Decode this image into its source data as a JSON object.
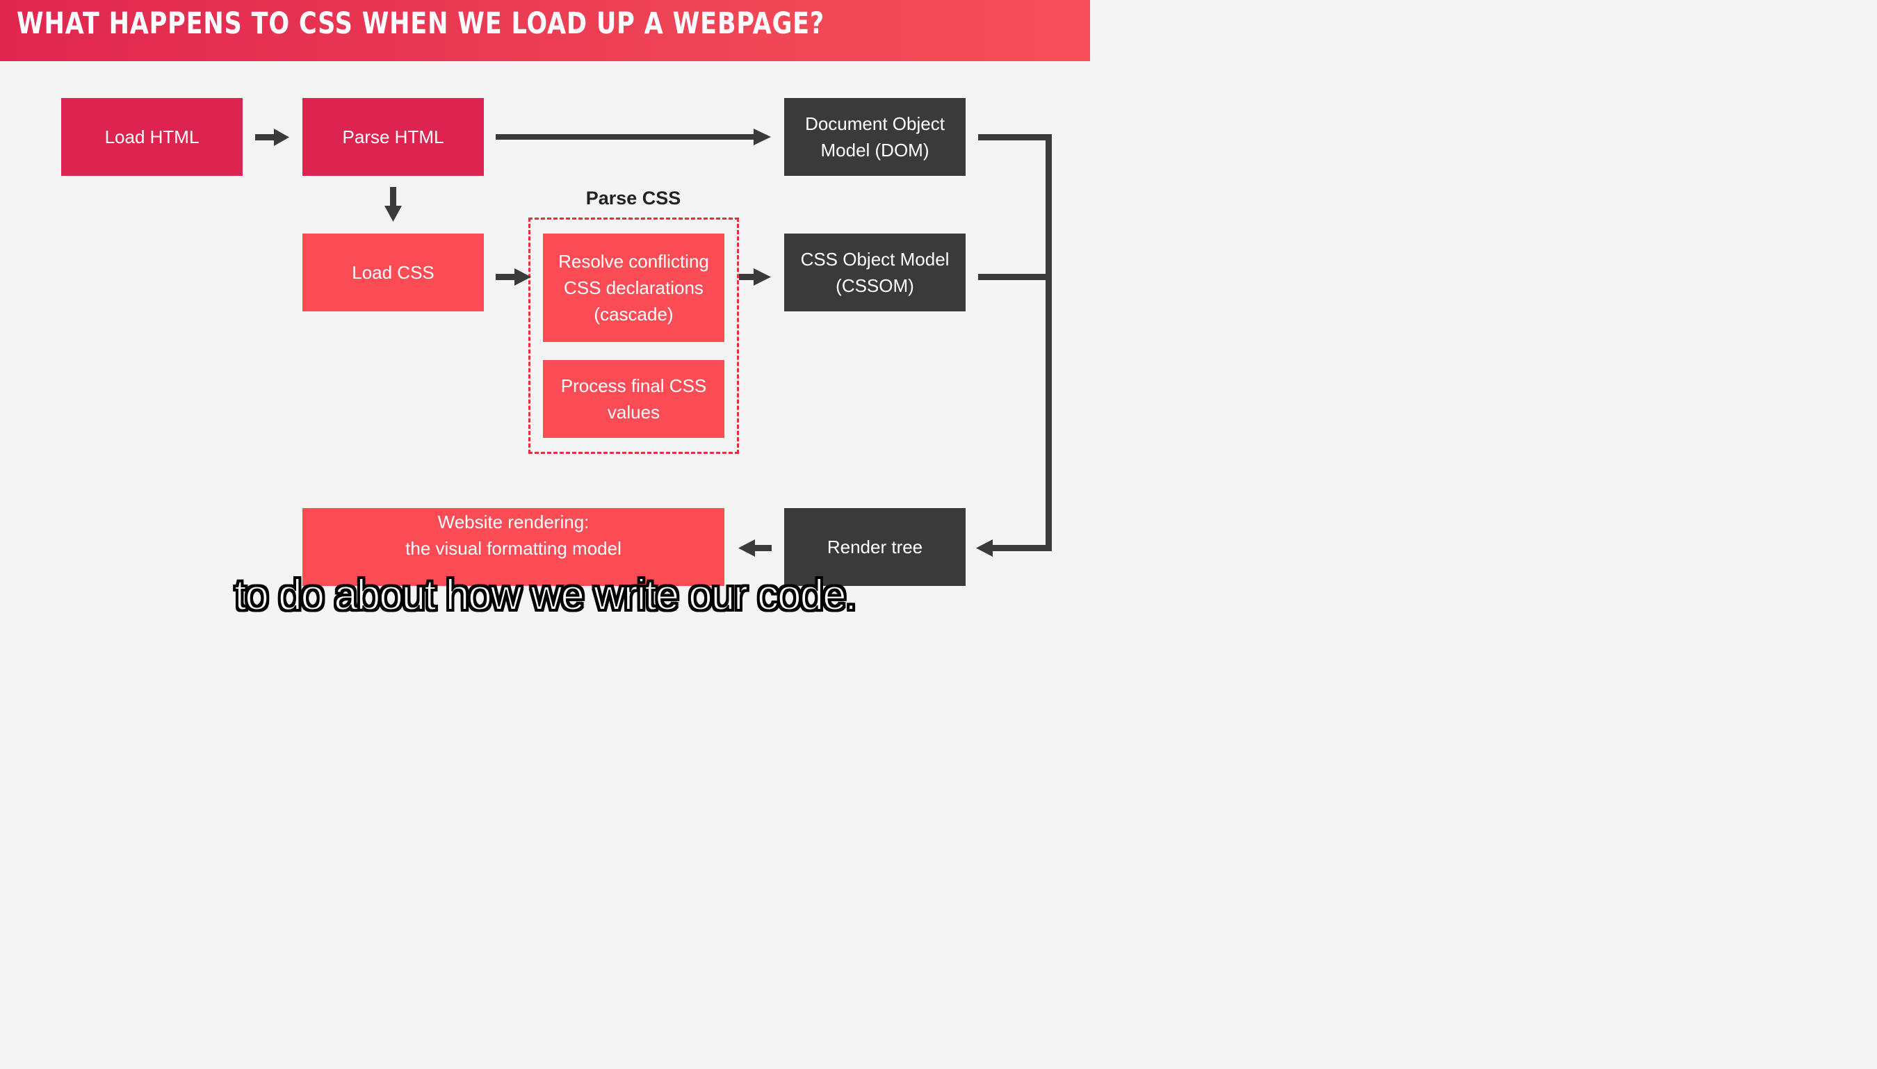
{
  "header": {
    "title": "WHAT HAPPENS TO CSS WHEN WE LOAD UP A WEBPAGE?"
  },
  "diagram": {
    "load_html": "Load HTML",
    "parse_html": "Parse HTML",
    "dom": "Document Object\nModel (DOM)",
    "parse_css_label": "Parse CSS",
    "load_css": "Load CSS",
    "resolve": "Resolve conflicting\nCSS declarations\n(cascade)",
    "process": "Process final CSS\nvalues",
    "cssom": "CSS Object Model\n(CSSOM)",
    "render_tree": "Render tree",
    "website_rendering": "Website rendering:\nthe visual formatting model"
  },
  "subtitle": "to do about how we write our code.",
  "colors": {
    "header": "#e0264f",
    "dark_red": "#dd2350",
    "coral": "#fb4b54",
    "dark": "#3a3a3a",
    "arrow": "#3a3a3a",
    "dashed_border": "#e8303d"
  }
}
